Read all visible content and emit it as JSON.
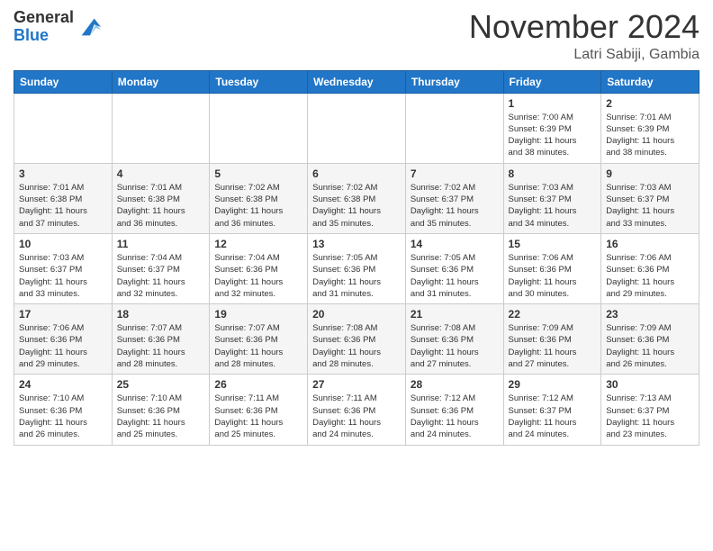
{
  "header": {
    "logo_line1": "General",
    "logo_line2": "Blue",
    "month": "November 2024",
    "location": "Latri Sabiji, Gambia"
  },
  "weekdays": [
    "Sunday",
    "Monday",
    "Tuesday",
    "Wednesday",
    "Thursday",
    "Friday",
    "Saturday"
  ],
  "weeks": [
    [
      {
        "day": "",
        "info": ""
      },
      {
        "day": "",
        "info": ""
      },
      {
        "day": "",
        "info": ""
      },
      {
        "day": "",
        "info": ""
      },
      {
        "day": "",
        "info": ""
      },
      {
        "day": "1",
        "info": "Sunrise: 7:00 AM\nSunset: 6:39 PM\nDaylight: 11 hours\nand 38 minutes."
      },
      {
        "day": "2",
        "info": "Sunrise: 7:01 AM\nSunset: 6:39 PM\nDaylight: 11 hours\nand 38 minutes."
      }
    ],
    [
      {
        "day": "3",
        "info": "Sunrise: 7:01 AM\nSunset: 6:38 PM\nDaylight: 11 hours\nand 37 minutes."
      },
      {
        "day": "4",
        "info": "Sunrise: 7:01 AM\nSunset: 6:38 PM\nDaylight: 11 hours\nand 36 minutes."
      },
      {
        "day": "5",
        "info": "Sunrise: 7:02 AM\nSunset: 6:38 PM\nDaylight: 11 hours\nand 36 minutes."
      },
      {
        "day": "6",
        "info": "Sunrise: 7:02 AM\nSunset: 6:38 PM\nDaylight: 11 hours\nand 35 minutes."
      },
      {
        "day": "7",
        "info": "Sunrise: 7:02 AM\nSunset: 6:37 PM\nDaylight: 11 hours\nand 35 minutes."
      },
      {
        "day": "8",
        "info": "Sunrise: 7:03 AM\nSunset: 6:37 PM\nDaylight: 11 hours\nand 34 minutes."
      },
      {
        "day": "9",
        "info": "Sunrise: 7:03 AM\nSunset: 6:37 PM\nDaylight: 11 hours\nand 33 minutes."
      }
    ],
    [
      {
        "day": "10",
        "info": "Sunrise: 7:03 AM\nSunset: 6:37 PM\nDaylight: 11 hours\nand 33 minutes."
      },
      {
        "day": "11",
        "info": "Sunrise: 7:04 AM\nSunset: 6:37 PM\nDaylight: 11 hours\nand 32 minutes."
      },
      {
        "day": "12",
        "info": "Sunrise: 7:04 AM\nSunset: 6:36 PM\nDaylight: 11 hours\nand 32 minutes."
      },
      {
        "day": "13",
        "info": "Sunrise: 7:05 AM\nSunset: 6:36 PM\nDaylight: 11 hours\nand 31 minutes."
      },
      {
        "day": "14",
        "info": "Sunrise: 7:05 AM\nSunset: 6:36 PM\nDaylight: 11 hours\nand 31 minutes."
      },
      {
        "day": "15",
        "info": "Sunrise: 7:06 AM\nSunset: 6:36 PM\nDaylight: 11 hours\nand 30 minutes."
      },
      {
        "day": "16",
        "info": "Sunrise: 7:06 AM\nSunset: 6:36 PM\nDaylight: 11 hours\nand 29 minutes."
      }
    ],
    [
      {
        "day": "17",
        "info": "Sunrise: 7:06 AM\nSunset: 6:36 PM\nDaylight: 11 hours\nand 29 minutes."
      },
      {
        "day": "18",
        "info": "Sunrise: 7:07 AM\nSunset: 6:36 PM\nDaylight: 11 hours\nand 28 minutes."
      },
      {
        "day": "19",
        "info": "Sunrise: 7:07 AM\nSunset: 6:36 PM\nDaylight: 11 hours\nand 28 minutes."
      },
      {
        "day": "20",
        "info": "Sunrise: 7:08 AM\nSunset: 6:36 PM\nDaylight: 11 hours\nand 28 minutes."
      },
      {
        "day": "21",
        "info": "Sunrise: 7:08 AM\nSunset: 6:36 PM\nDaylight: 11 hours\nand 27 minutes."
      },
      {
        "day": "22",
        "info": "Sunrise: 7:09 AM\nSunset: 6:36 PM\nDaylight: 11 hours\nand 27 minutes."
      },
      {
        "day": "23",
        "info": "Sunrise: 7:09 AM\nSunset: 6:36 PM\nDaylight: 11 hours\nand 26 minutes."
      }
    ],
    [
      {
        "day": "24",
        "info": "Sunrise: 7:10 AM\nSunset: 6:36 PM\nDaylight: 11 hours\nand 26 minutes."
      },
      {
        "day": "25",
        "info": "Sunrise: 7:10 AM\nSunset: 6:36 PM\nDaylight: 11 hours\nand 25 minutes."
      },
      {
        "day": "26",
        "info": "Sunrise: 7:11 AM\nSunset: 6:36 PM\nDaylight: 11 hours\nand 25 minutes."
      },
      {
        "day": "27",
        "info": "Sunrise: 7:11 AM\nSunset: 6:36 PM\nDaylight: 11 hours\nand 24 minutes."
      },
      {
        "day": "28",
        "info": "Sunrise: 7:12 AM\nSunset: 6:36 PM\nDaylight: 11 hours\nand 24 minutes."
      },
      {
        "day": "29",
        "info": "Sunrise: 7:12 AM\nSunset: 6:37 PM\nDaylight: 11 hours\nand 24 minutes."
      },
      {
        "day": "30",
        "info": "Sunrise: 7:13 AM\nSunset: 6:37 PM\nDaylight: 11 hours\nand 23 minutes."
      }
    ]
  ]
}
